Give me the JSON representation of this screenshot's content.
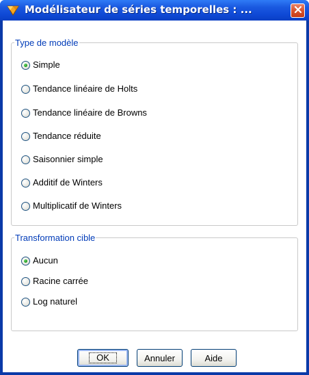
{
  "window": {
    "title": "Modélisateur de séries temporelles : ...",
    "icon": "diamond-node-icon",
    "close_icon": "close-icon"
  },
  "model_type": {
    "legend": "Type de modèle",
    "options": [
      {
        "label": "Simple",
        "checked": true
      },
      {
        "label": "Tendance linéaire de Holts",
        "checked": false
      },
      {
        "label": "Tendance linéaire de Browns",
        "checked": false
      },
      {
        "label": "Tendance réduite",
        "checked": false
      },
      {
        "label": "Saisonnier simple",
        "checked": false
      },
      {
        "label": "Additif de Winters",
        "checked": false
      },
      {
        "label": "Multiplicatif de Winters",
        "checked": false
      }
    ]
  },
  "target_transform": {
    "legend": "Transformation cible",
    "options": [
      {
        "label": "Aucun",
        "checked": true
      },
      {
        "label": "Racine carrée",
        "checked": false
      },
      {
        "label": "Log naturel",
        "checked": false
      }
    ]
  },
  "buttons": {
    "ok": "OK",
    "cancel": "Annuler",
    "help": "Aide"
  },
  "colors": {
    "titlebar": "#0f49d6",
    "group_legend": "#003bb8",
    "close_button": "#d9542e",
    "radio_checked": "#21a121"
  }
}
